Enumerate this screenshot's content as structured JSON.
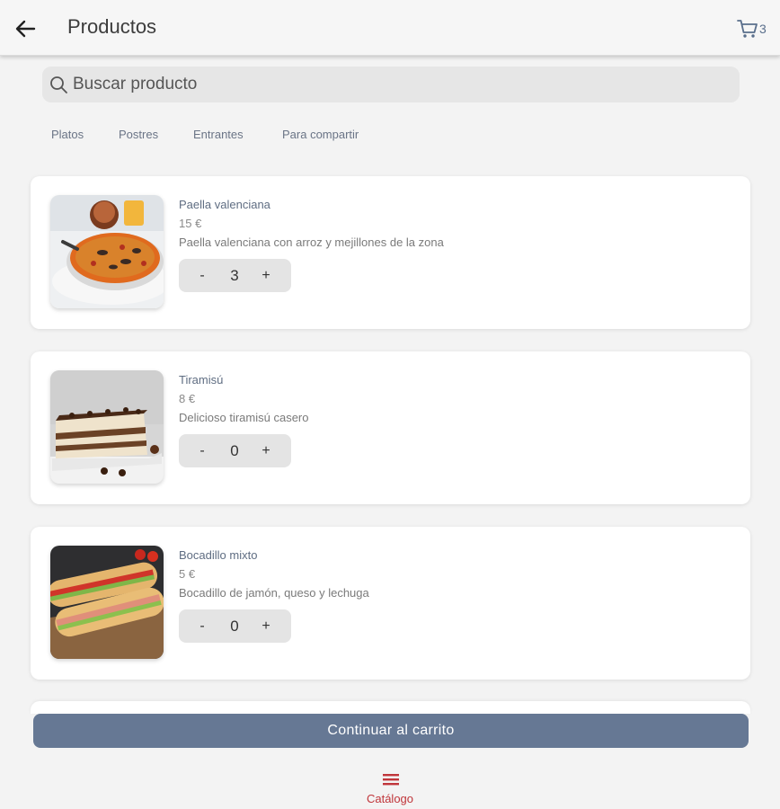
{
  "header": {
    "title": "Productos",
    "back_icon": "arrow-left-icon",
    "cart_icon": "cart-icon",
    "cart_count": "3"
  },
  "search": {
    "placeholder": "Buscar producto",
    "value": ""
  },
  "tabs": [
    {
      "label": "Platos"
    },
    {
      "label": "Postres"
    },
    {
      "label": "Entrantes"
    },
    {
      "label": "Para compartir"
    }
  ],
  "products": [
    {
      "name": "Paella valenciana",
      "price": "15 €",
      "description": "Paella valenciana con arroz y mejillones de la zona",
      "quantity": "3",
      "minus_label": "-",
      "plus_label": "+"
    },
    {
      "name": "Tiramisú",
      "price": "8 €",
      "description": "Delicioso tiramisú casero",
      "quantity": "0",
      "minus_label": "-",
      "plus_label": "+"
    },
    {
      "name": "Bocadillo mixto",
      "price": "5 €",
      "description": "Bocadillo de jamón, queso y lechuga",
      "quantity": "0",
      "minus_label": "-",
      "plus_label": "+"
    }
  ],
  "continue_button": "Continuar al carrito",
  "bottom_nav": {
    "label": "Catálogo",
    "icon": "menu-icon"
  },
  "colors": {
    "accent": "#667894",
    "active_nav": "#c0353a",
    "background": "#f3f3f3"
  }
}
